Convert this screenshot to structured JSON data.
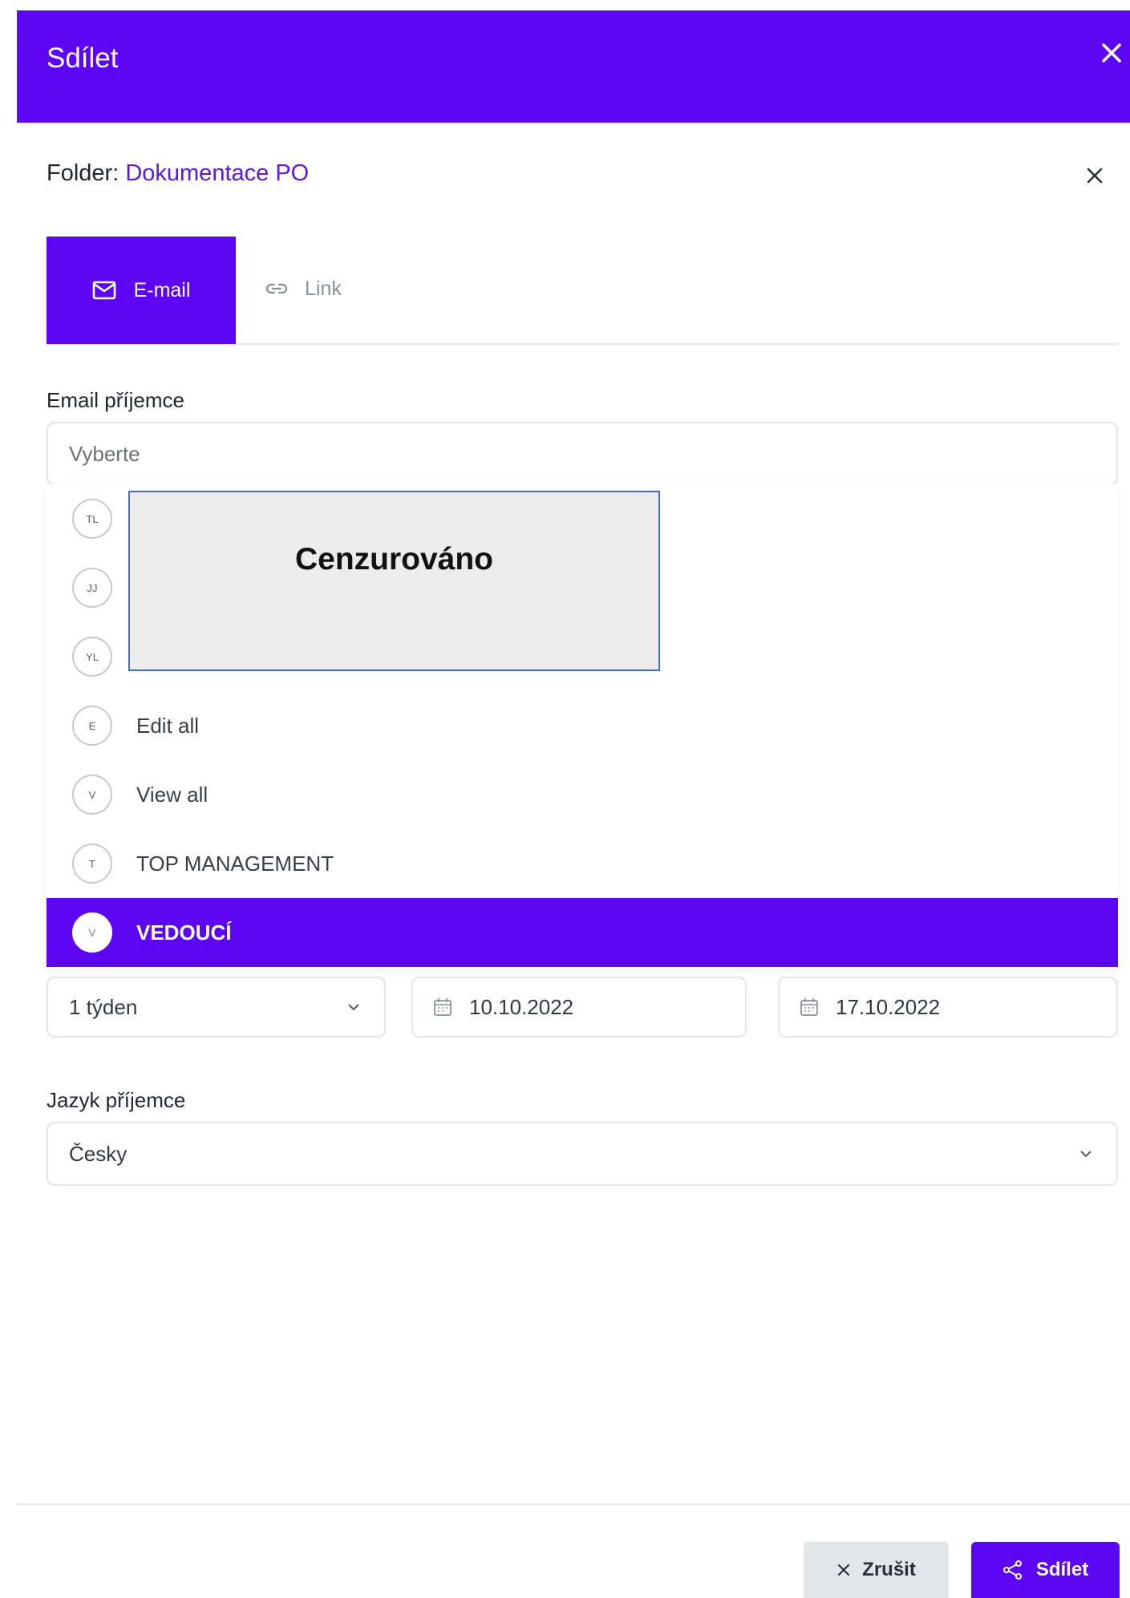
{
  "header": {
    "title": "Sdílet",
    "close_icon": "close-icon"
  },
  "folder": {
    "prefix": "Folder:",
    "name": "Dokumentace PO",
    "close_icon": "close-icon"
  },
  "tabs": [
    {
      "label": "E-mail",
      "icon": "mail-icon",
      "active": true
    },
    {
      "label": "Link",
      "icon": "link-icon",
      "active": false
    }
  ],
  "recipient": {
    "label": "Email příjemce",
    "placeholder": "Vyberte",
    "options": [
      {
        "initials": "TL",
        "label": ""
      },
      {
        "initials": "JJ",
        "label": ""
      },
      {
        "initials": "YL",
        "label": ""
      },
      {
        "initials": "E",
        "label": "Edit all"
      },
      {
        "initials": "V",
        "label": "View all"
      },
      {
        "initials": "T",
        "label": "TOP MANAGEMENT"
      },
      {
        "initials": "V",
        "label": "VEDOUCÍ",
        "selected": true
      }
    ],
    "redaction_text": "Cenzurováno"
  },
  "validity": {
    "duration": "1 týden",
    "date_from": "10.10.2022",
    "date_to": "17.10.2022"
  },
  "language": {
    "label": "Jazyk příjemce",
    "value": "Česky"
  },
  "footer": {
    "cancel_label": "Zrušit",
    "share_label": "Sdílet"
  },
  "colors": {
    "accent": "#5d06f4",
    "folder_link": "#5b17e3",
    "cancel_bg": "#e4e5e9"
  }
}
